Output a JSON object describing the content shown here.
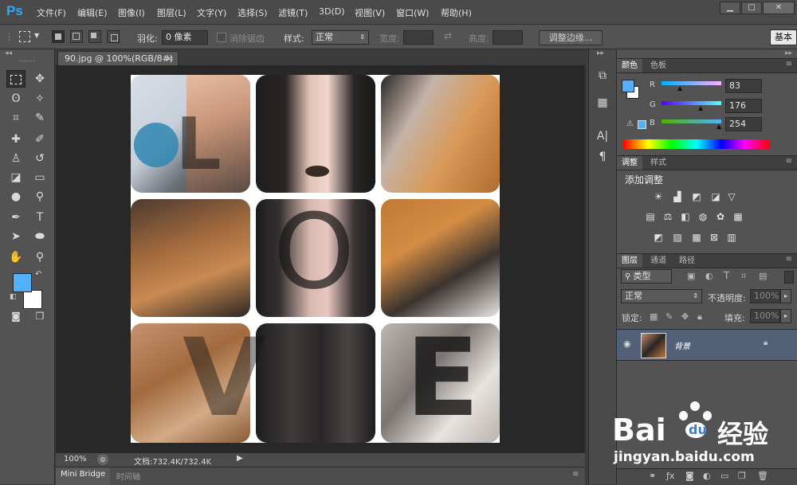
{
  "app": {
    "logo": "Ps"
  },
  "menu": [
    "文件(F)",
    "编辑(E)",
    "图像(I)",
    "图层(L)",
    "文字(Y)",
    "选择(S)",
    "滤镜(T)",
    "3D(D)",
    "视图(V)",
    "窗口(W)",
    "帮助(H)"
  ],
  "window_controls": {
    "minimize": "▁",
    "restore": "□",
    "close": "✕"
  },
  "options": {
    "feather_label": "羽化:",
    "feather_value": "0 像素",
    "antialias_label": "消除锯齿",
    "style_label": "样式:",
    "style_value": "正常",
    "width_label": "宽度:",
    "height_label": "高度:",
    "refine_edge": "调整边缘...",
    "workspace": "基本"
  },
  "document": {
    "tab_title": "90.jpg @ 100%(RGB/8#)",
    "close": "×"
  },
  "letters": [
    "L",
    "O",
    "V",
    "E"
  ],
  "status": {
    "zoom": "100%",
    "doc_info": "文档:732.4K/732.4K"
  },
  "bottom_tabs": [
    "Mini Bridge",
    "时间轴"
  ],
  "color_panel": {
    "tabs": [
      "颜色",
      "色板"
    ],
    "r_label": "R",
    "g_label": "G",
    "b_label": "B",
    "r": "83",
    "g": "176",
    "b": "254",
    "warning_icon": "⚠"
  },
  "adjustments_panel": {
    "tabs": [
      "调整",
      "样式"
    ],
    "title": "添加调整"
  },
  "layers_panel": {
    "tabs": [
      "图层",
      "通道",
      "路径"
    ],
    "kind_filter": "类型",
    "blend_mode": "正常",
    "opacity_label": "不透明度:",
    "opacity_value": "100%",
    "lock_label": "锁定:",
    "fill_label": "填充:",
    "fill_value": "100%",
    "layer_name": "背景"
  },
  "watermark": {
    "brand": "Bai",
    "brand2": "经验",
    "url": "jingyan.baidu.com"
  },
  "colors": {
    "foreground": "#53b0fe",
    "background": "#ffffff",
    "accent": "#31a8ff"
  }
}
